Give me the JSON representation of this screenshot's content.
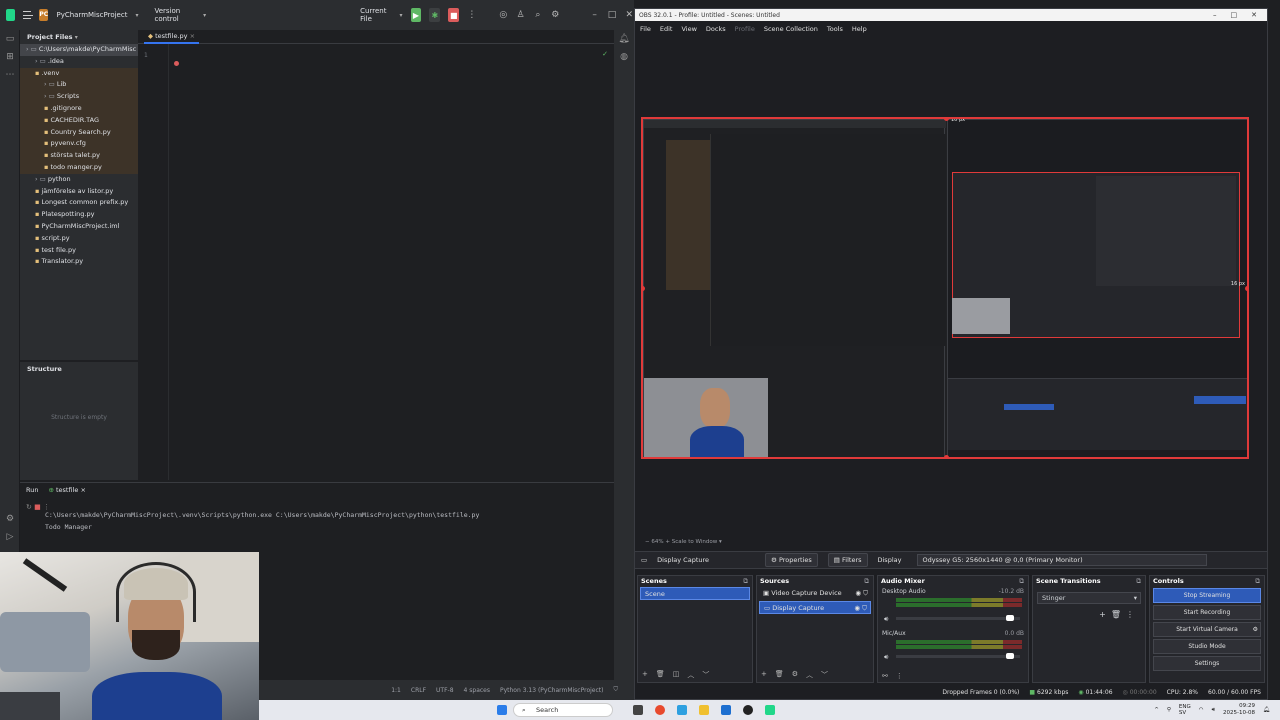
{
  "pycharm": {
    "project_badge": "PC",
    "project_name": "PyCharmMiscProject",
    "vcs_label": "Version control",
    "run_config": "Current File",
    "project_panel_title": "Project Files",
    "tree": [
      {
        "label": "C:\\Users\\makde\\PyCharmMisc",
        "indent": 0,
        "type": "root"
      },
      {
        "label": ".idea",
        "indent": 1,
        "type": "folder"
      },
      {
        "label": ".venv",
        "indent": 1,
        "type": "venv"
      },
      {
        "label": "Lib",
        "indent": 2,
        "type": "venv"
      },
      {
        "label": "Scripts",
        "indent": 2,
        "type": "venv"
      },
      {
        "label": ".gitignore",
        "indent": 2,
        "type": "venv"
      },
      {
        "label": "CACHEDIR.TAG",
        "indent": 2,
        "type": "venv"
      },
      {
        "label": "Country Search.py",
        "indent": 2,
        "type": "venv"
      },
      {
        "label": "pyvenv.cfg",
        "indent": 2,
        "type": "venv"
      },
      {
        "label": "största talet.py",
        "indent": 2,
        "type": "venv"
      },
      {
        "label": "todo manger.py",
        "indent": 2,
        "type": "venv"
      },
      {
        "label": "python",
        "indent": 1,
        "type": "folder"
      },
      {
        "label": "jämförelse av listor.py",
        "indent": 1,
        "type": "file"
      },
      {
        "label": "Longest common prefix.py",
        "indent": 1,
        "type": "file"
      },
      {
        "label": "Platespotting.py",
        "indent": 1,
        "type": "file"
      },
      {
        "label": "PyCharmMiscProject.iml",
        "indent": 1,
        "type": "file"
      },
      {
        "label": "script.py",
        "indent": 1,
        "type": "file"
      },
      {
        "label": "test file.py",
        "indent": 1,
        "type": "file"
      },
      {
        "label": "Translator.py",
        "indent": 1,
        "type": "file"
      }
    ],
    "structure_title": "Structure",
    "structure_empty": "Structure is empty",
    "editor_tab": "testfile.py",
    "line_number": "1",
    "run_label": "Run",
    "run_tab": "testfile",
    "console_lines": [
      "C:\\Users\\makde\\PyCharmMiscProject\\.venv\\Scripts\\python.exe C:\\Users\\makde\\PyCharmMiscProject\\python\\testfile.py",
      "Todo Manager"
    ],
    "status": {
      "position": "1:1",
      "line_sep": "CRLF",
      "encoding": "UTF-8",
      "indent": "4 spaces",
      "interpreter": "Python 3.13 (PyCharmMiscProject)"
    }
  },
  "obs": {
    "title": "OBS 32.0.1 - Profile: Untitled - Scenes: Untitled",
    "menu": [
      "File",
      "Edit",
      "View",
      "Docks",
      "Profile",
      "Scene Collection",
      "Tools",
      "Help"
    ],
    "px_top": "10 px",
    "px_right": "16 px",
    "zoom": "64%",
    "scale_mode": "Scale to Window",
    "source_name": "Display Capture",
    "properties": "Properties",
    "filters": "Filters",
    "display_label": "Display",
    "display_value": "Odyssey G5: 2560x1440 @ 0,0 (Primary Monitor)",
    "scenes_title": "Scenes",
    "scenes": [
      "Scene"
    ],
    "sources_title": "Sources",
    "sources": [
      "Video Capture Device",
      "Display Capture"
    ],
    "mixer_title": "Audio Mixer",
    "mixer": [
      {
        "name": "Desktop Audio",
        "db": "-10.2 dB",
        "level": 0.75
      },
      {
        "name": "Mic/Aux",
        "db": "0.0 dB",
        "level": 0.55
      }
    ],
    "transitions_title": "Scene Transitions",
    "transition": "Stinger",
    "controls_title": "Controls",
    "controls": [
      "Stop Streaming",
      "Start Recording",
      "Start Virtual Camera",
      "Studio Mode",
      "Settings"
    ],
    "status": {
      "dropped": "Dropped Frames 0 (0.0%)",
      "bitrate": "6292 kbps",
      "stream_time": "01:44:06",
      "rec_time": "00:00:00",
      "cpu": "CPU: 2.8%",
      "fps": "60.00 / 60.00 FPS"
    }
  },
  "taskbar": {
    "search": "Search",
    "lang": "ENG",
    "region": "SV",
    "time": "09:29",
    "date": "2025-10-08"
  },
  "colors": {
    "accent": "#3574f0",
    "obs_select": "#2e5bb8",
    "preview_border": "#e03a3a",
    "run_green": "#5fb865",
    "stop_red": "#db5c5c"
  }
}
